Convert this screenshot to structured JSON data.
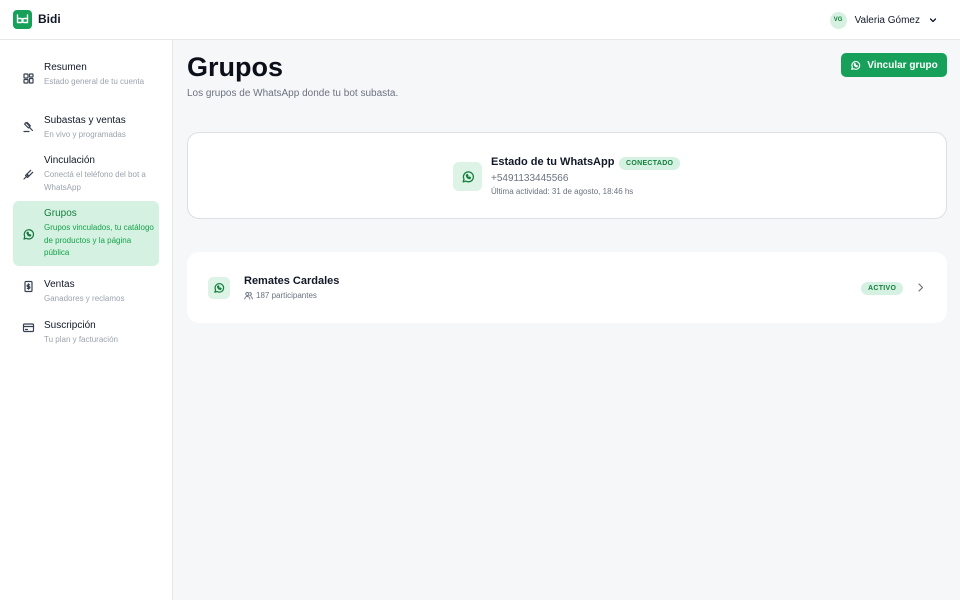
{
  "app": {
    "brand": "Bidi"
  },
  "user": {
    "initials": "VG",
    "name": "Valeria Gómez"
  },
  "sidebar": {
    "items": [
      {
        "label": "Resumen",
        "description": "Estado general de tu cuenta",
        "icon": "grid-icon"
      },
      {
        "label": "Subastas y ventas",
        "description": "En vivo y programadas",
        "icon": "gavel-icon"
      },
      {
        "label": "Vinculación",
        "description": "Conectá el teléfono del bot a WhatsApp",
        "icon": "plug-icon"
      },
      {
        "label": "Grupos",
        "description": "Grupos vinculados, tu catálogo de productos y la página pública",
        "icon": "whatsapp-icon",
        "active": true
      },
      {
        "label": "Ventas",
        "description": "Ganadores y reclamos",
        "icon": "receipt-icon"
      },
      {
        "label": "Suscripción",
        "description": "Tu plan y facturación",
        "icon": "credit-card-icon"
      }
    ]
  },
  "main": {
    "title": "Grupos",
    "subtitle": "Los grupos de WhatsApp donde tu bot subasta.",
    "link_button": "Vincular grupo"
  },
  "whatsapp_status": {
    "title": "Estado de tu WhatsApp",
    "badge": "CONECTADO",
    "phone": "+5491133445566",
    "last_activity": "Última actividad: 31 de agosto, 18:46 hs"
  },
  "groups": [
    {
      "name": "Remates Cardales",
      "participants": "187 participantes",
      "status": "ACTIVO"
    }
  ],
  "colors": {
    "accent": "#16a05a",
    "accent_light": "#d5f1e2",
    "accent_text": "#15803d"
  }
}
